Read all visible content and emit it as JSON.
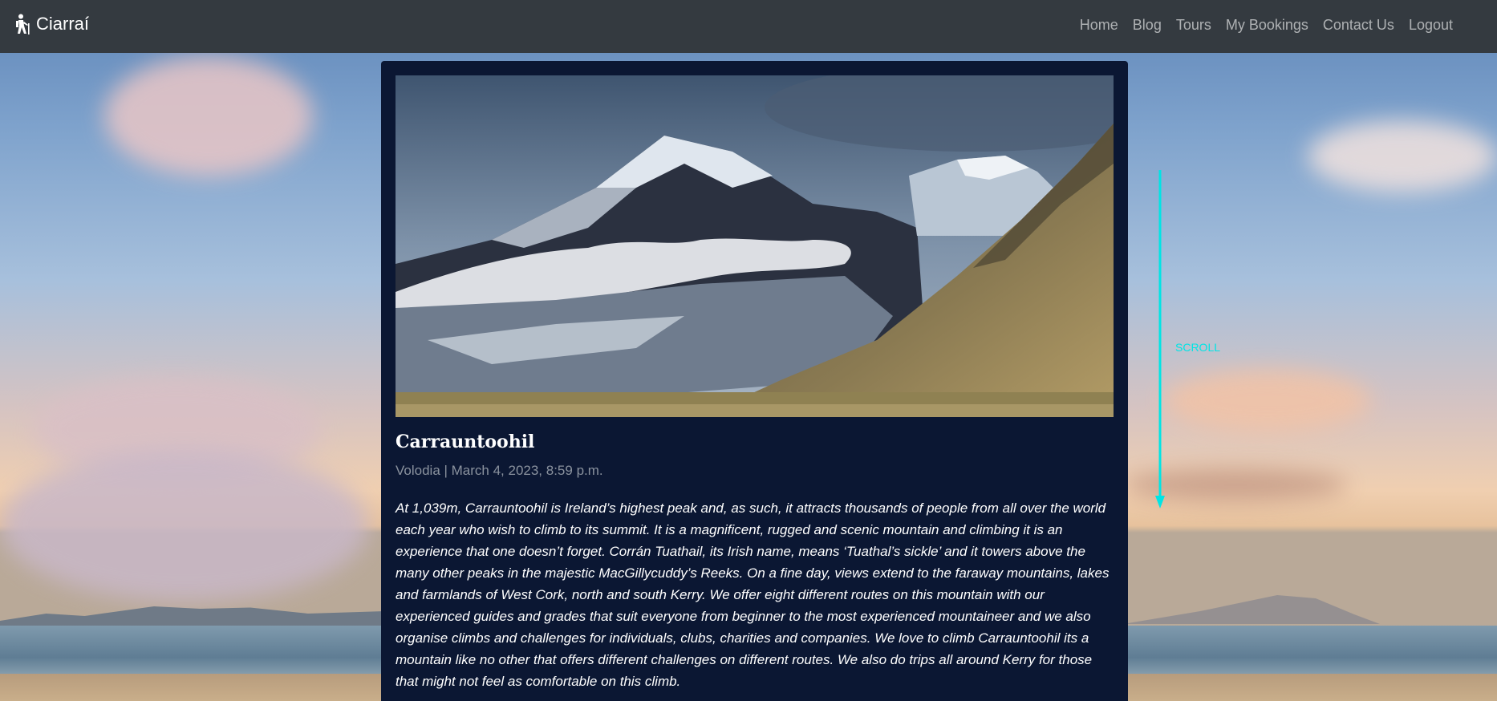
{
  "nav": {
    "brand": "Ciarraí",
    "links": [
      "Home",
      "Blog",
      "Tours",
      "My Bookings",
      "Contact Us",
      "Logout"
    ]
  },
  "post": {
    "title": "Carrauntoohil",
    "meta": "Volodia | March 4, 2023, 8:59 p.m.",
    "body": "At 1,039m, Carrauntoohil is Ireland’s highest peak and, as such, it attracts thousands of people from all over the world each year who wish to climb to its summit. It is a magnificent, rugged and scenic mountain and climbing it is an experience that one doesn’t forget. Corrán Tuathail, its Irish name, means ‘Tuathal’s sickle’ and it towers above the many other peaks in the majestic MacGillycuddy’s Reeks. On a fine day, views extend to the faraway mountains, lakes and farmlands of West Cork, north and south Kerry. We offer eight different routes on this mountain with our experienced guides and grades that suit everyone from beginner to the most experienced mountaineer and we also organise climbs and challenges for individuals, clubs, charities and companies. We love to climb Carrauntoohil its a mountain like no other that offers different challenges on different routes. We also do trips all around Kerry for those that might not feel as comfortable on this climb."
  },
  "scroll_hint": {
    "label": "SCROLL",
    "color": "#00e5e5"
  },
  "colors": {
    "navbar": "#343a40",
    "card": "#0b1733",
    "meta_text": "#8a929e"
  },
  "icons": {
    "brand": "hiker-icon"
  }
}
